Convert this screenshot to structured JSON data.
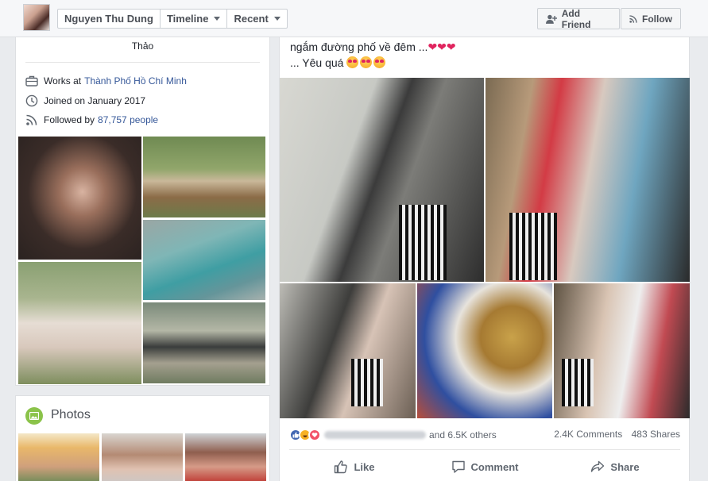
{
  "header": {
    "profile_name": "Nguyen Thu Dung",
    "timeline_label": "Timeline",
    "recent_label": "Recent",
    "add_friend_label": "Add Friend",
    "follow_label": "Follow"
  },
  "intro": {
    "name_tail": "Thảo",
    "works_prefix": "Works at",
    "works_place": "Thành Phố Hồ Chí Minh",
    "joined": "Joined on January 2017",
    "followed_prefix": "Followed by",
    "followed_link": "87,757 people"
  },
  "photos_section": {
    "title": "Photos"
  },
  "post": {
    "line1": "ngắm đường phố về đêm ...",
    "line2": "... Yêu quá",
    "reactions_others": "and 6.5K others",
    "comments": "2.4K Comments",
    "shares": "483 Shares",
    "like_label": "Like",
    "comment_label": "Comment",
    "share_label": "Share"
  },
  "icons": {
    "reactions": [
      "like-icon",
      "haha-icon",
      "love-icon"
    ],
    "accent": "#4267b2",
    "love": "#f25268"
  }
}
